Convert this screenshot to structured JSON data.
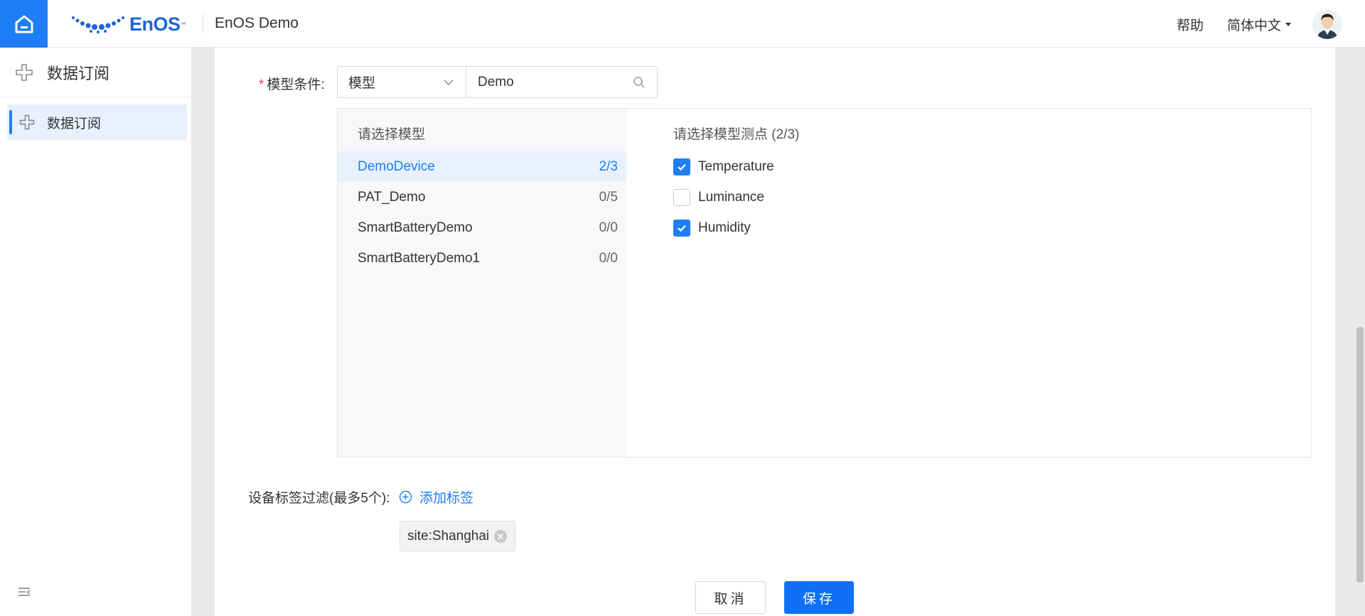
{
  "header": {
    "logo_text": "EnOS",
    "logo_tm": "™",
    "app_title": "EnOS Demo",
    "help": "帮助",
    "language": "简体中文"
  },
  "sidebar": {
    "title": "数据订阅",
    "items": [
      {
        "label": "数据订阅",
        "active": true
      }
    ]
  },
  "form": {
    "model_condition_label": "模型条件:",
    "select_value": "模型",
    "search_value": "Demo",
    "picker": {
      "models_title": "请选择模型",
      "points_title": "请选择模型测点 (2/3)",
      "models": [
        {
          "name": "DemoDevice",
          "count": "2/3",
          "active": true
        },
        {
          "name": "PAT_Demo",
          "count": "0/5",
          "active": false
        },
        {
          "name": "SmartBatteryDemo",
          "count": "0/0",
          "active": false
        },
        {
          "name": "SmartBatteryDemo1",
          "count": "0/0",
          "active": false
        }
      ],
      "points": [
        {
          "name": "Temperature",
          "checked": true
        },
        {
          "name": "Luminance",
          "checked": false
        },
        {
          "name": "Humidity",
          "checked": true
        }
      ]
    },
    "tag_filter_label": "设备标签过滤(最多5个):",
    "add_tag": "添加标签",
    "tags": [
      "site:Shanghai"
    ]
  },
  "actions": {
    "cancel": "取消",
    "save": "保存"
  },
  "colors": {
    "primary": "#1e7ef5",
    "save_button": "#1070f5",
    "required": "#e54545"
  }
}
